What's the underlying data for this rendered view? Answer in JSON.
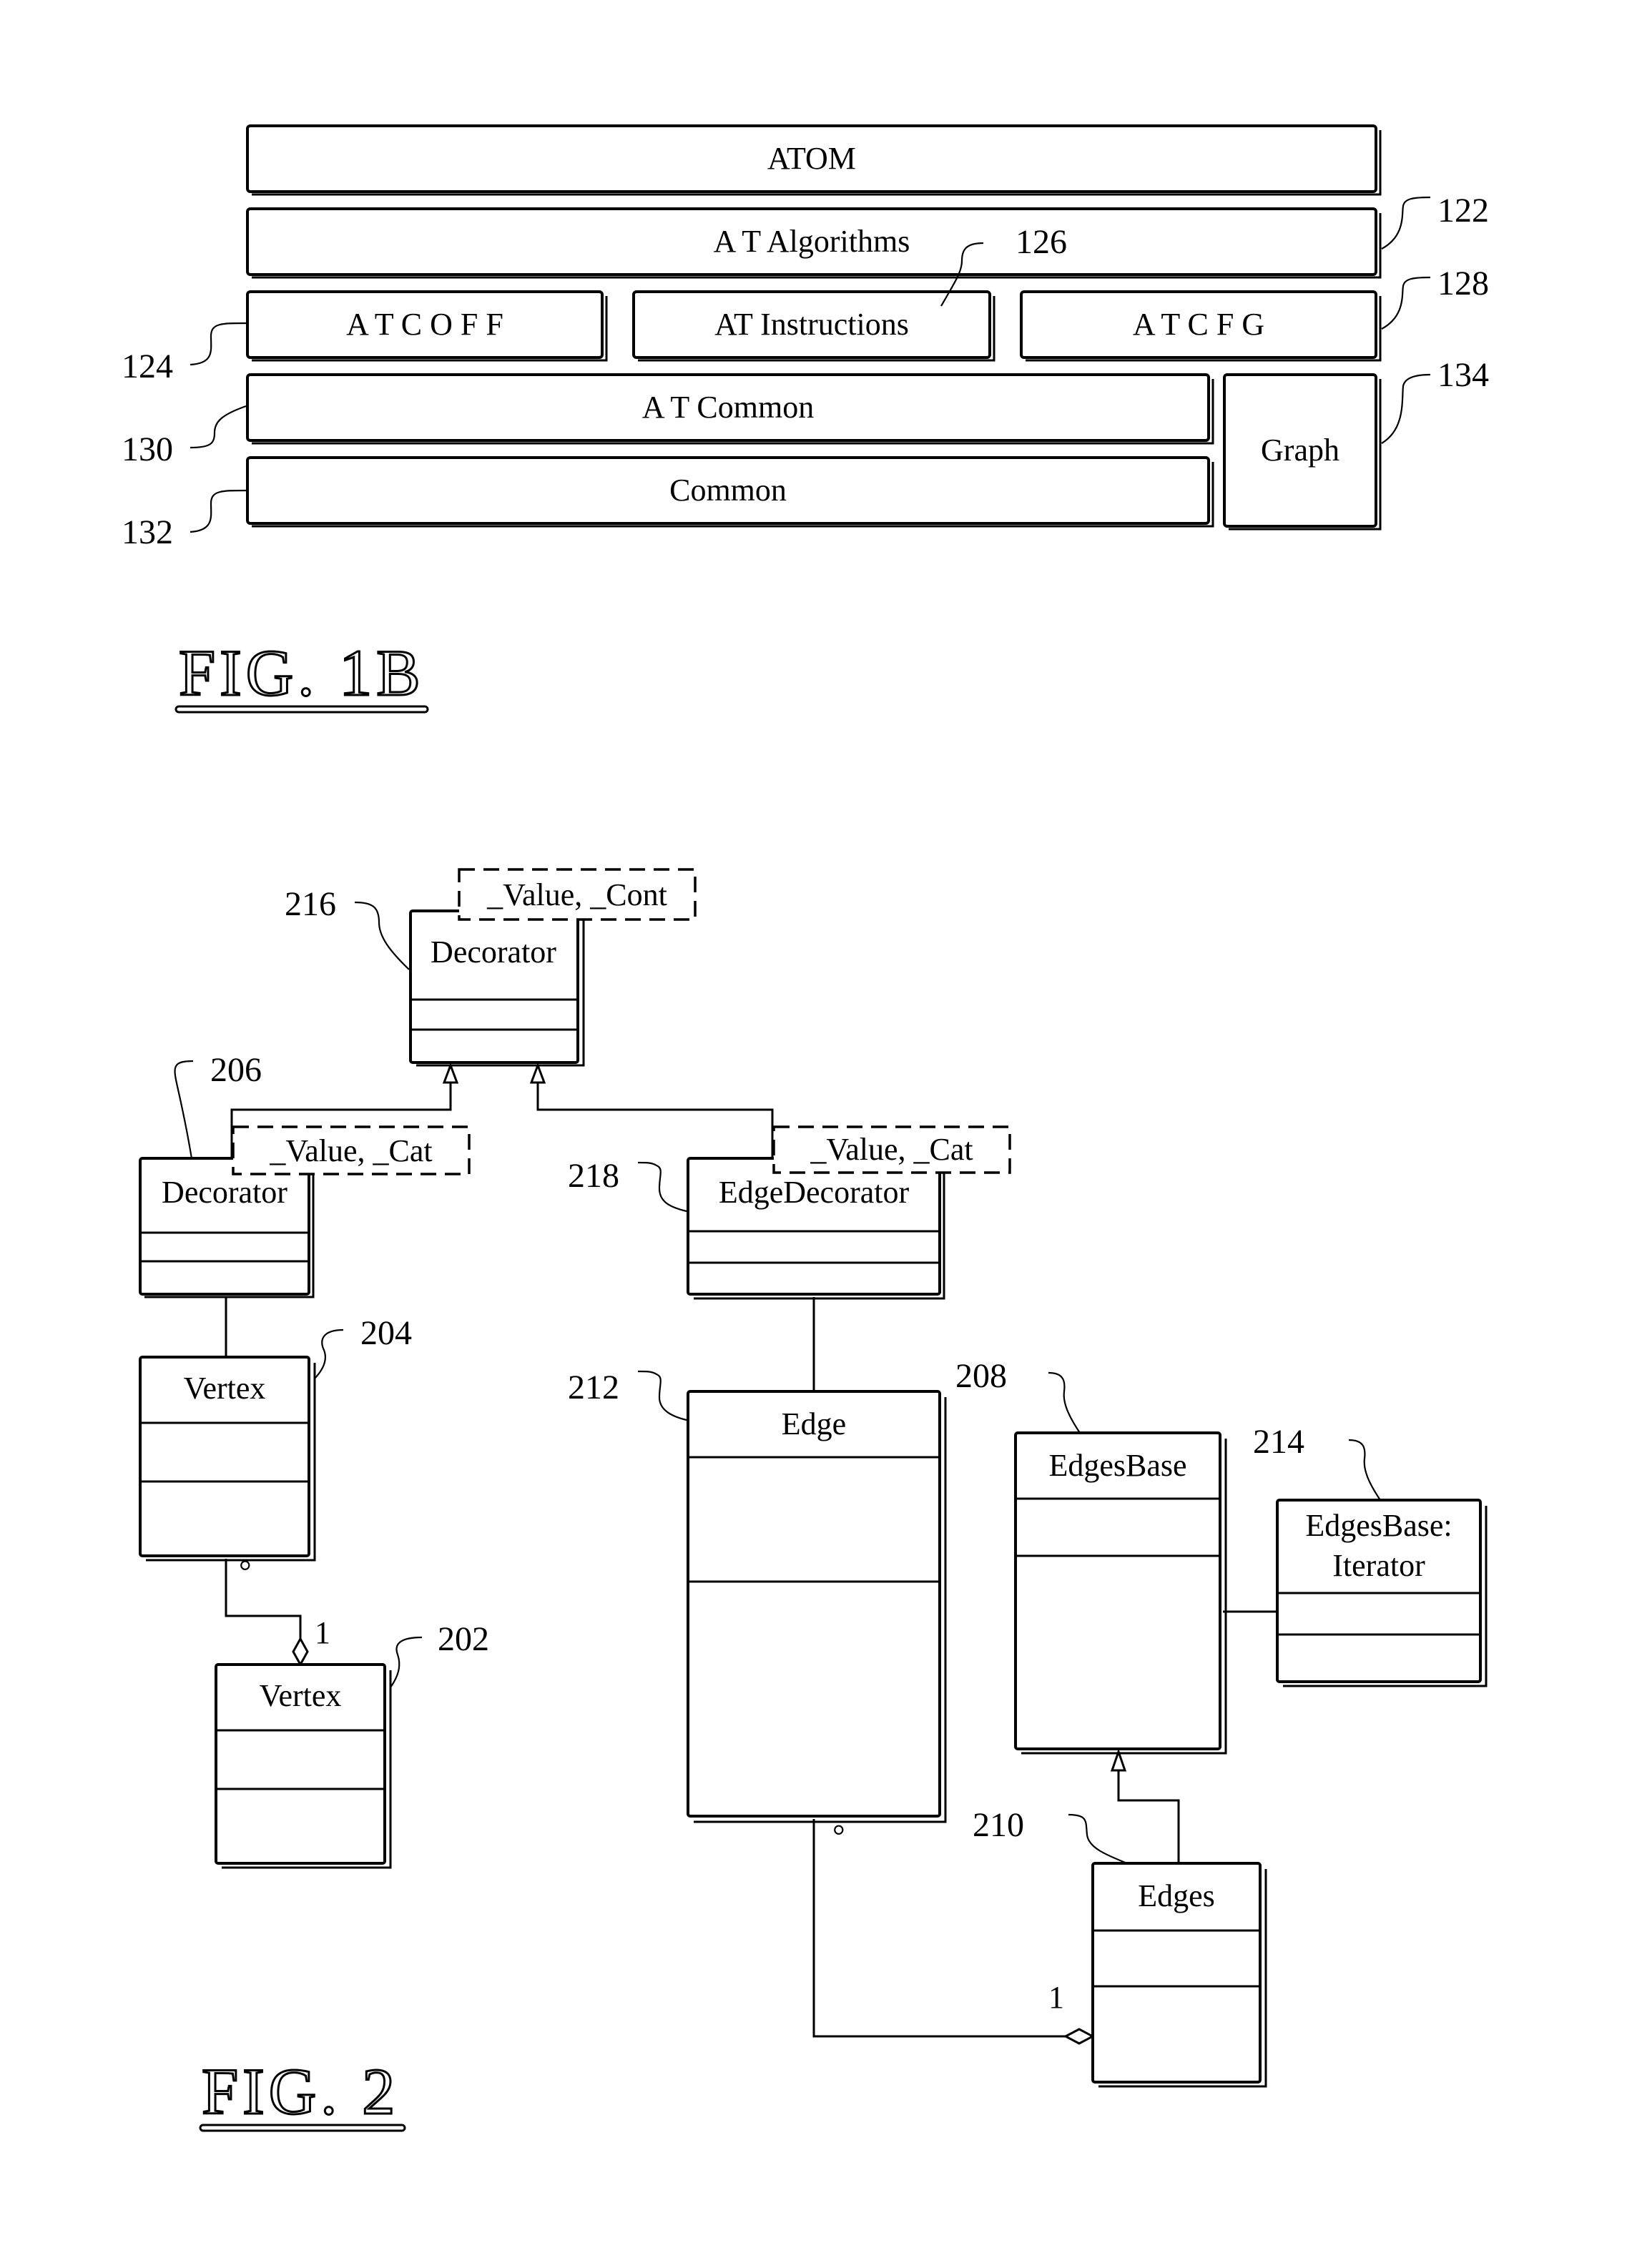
{
  "fig1b": {
    "caption": "FIG. 1B",
    "layers": {
      "atom": "ATOM",
      "at_algorithms": "A T Algorithms",
      "atcoff": "A T C O F F",
      "at_instructions": "AT Instructions",
      "atcfg": "A T C F G",
      "at_common": "A T Common",
      "common": "Common",
      "graph": "Graph"
    },
    "refs": {
      "r122": "122",
      "r124": "124",
      "r126": "126",
      "r128": "128",
      "r130": "130",
      "r132": "132",
      "r134": "134"
    }
  },
  "fig2": {
    "caption": "FIG. 2",
    "classes": {
      "decorator_216": {
        "name": "Decorator",
        "template": "_Value, _Cont",
        "ref": "216"
      },
      "decorator_206": {
        "name": "Decorator",
        "template": "_Value, _Cat",
        "ref": "206"
      },
      "edge_decorator_218": {
        "name": "EdgeDecorator",
        "template": "_Value, _Cat",
        "ref": "218"
      },
      "vertex_204": {
        "name": "Vertex",
        "ref": "204"
      },
      "vertex_202": {
        "name": "Vertex",
        "ref": "202"
      },
      "edge_212": {
        "name": "Edge",
        "ref": "212"
      },
      "edges_base_208": {
        "name": "EdgesBase",
        "ref": "208"
      },
      "edges_base_iterator_214": {
        "name_line1": "EdgesBase:",
        "name_line2": "Iterator",
        "ref": "214"
      },
      "edges_210": {
        "name": "Edges",
        "ref": "210"
      }
    },
    "multiplicities": {
      "vertex_many": "°",
      "vertex_one": "1",
      "edge_many": "°",
      "edge_one": "1"
    }
  }
}
